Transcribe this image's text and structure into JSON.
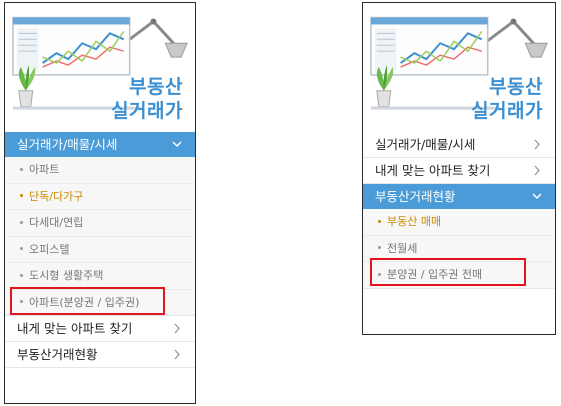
{
  "colors": {
    "accent": "#4a9bd8",
    "brand_text": "#3c8fd1",
    "active_sub": "#c98a00",
    "highlight": "#e0151d"
  },
  "left_panel": {
    "brand_line1": "부동산",
    "brand_line2": "실거래가",
    "menu": [
      {
        "label": "실거래가/매물/시세",
        "expanded": true,
        "icon": "chevron-down-icon",
        "sub_items": [
          {
            "label": "아파트",
            "active": false
          },
          {
            "label": "단독/다가구",
            "active": true
          },
          {
            "label": "다세대/연립",
            "active": false
          },
          {
            "label": "오피스텔",
            "active": false
          },
          {
            "label": "도시형 생활주택",
            "active": false
          },
          {
            "label": "아파트(분양권 / 입주권)",
            "active": false,
            "highlighted": true
          }
        ]
      },
      {
        "label": "내게 맞는 아파트 찾기",
        "expanded": false,
        "icon": "chevron-right-icon"
      },
      {
        "label": "부동산거래현황",
        "expanded": false,
        "icon": "chevron-right-icon"
      }
    ]
  },
  "right_panel": {
    "brand_line1": "부동산",
    "brand_line2": "실거래가",
    "menu": [
      {
        "label": "실거래가/매물/시세",
        "expanded": false,
        "icon": "chevron-right-icon"
      },
      {
        "label": "내게 맞는 아파트 찾기",
        "expanded": false,
        "icon": "chevron-right-icon"
      },
      {
        "label": "부동산거래현황",
        "expanded": true,
        "icon": "chevron-down-icon",
        "sub_items": [
          {
            "label": "부동산 매매",
            "active": true
          },
          {
            "label": "전월세",
            "active": false
          },
          {
            "label": "분양권 / 입주권 전매",
            "active": false,
            "highlighted": true
          }
        ]
      }
    ]
  }
}
